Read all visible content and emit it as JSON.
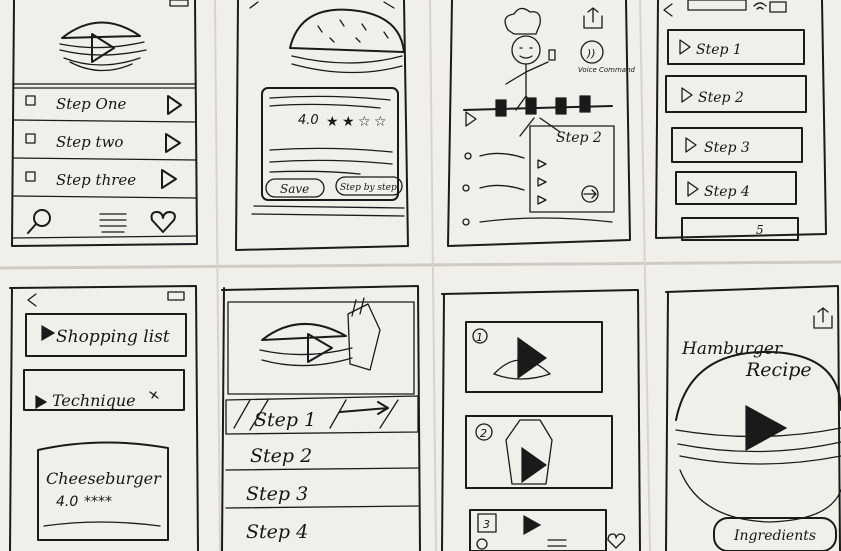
{
  "sheet": {
    "paper_color": "#f1efea",
    "shadow_color": "#d4d1cb",
    "ink_color": "#1a1a1a"
  },
  "frames": {
    "recipe_steps": {
      "steps": [
        {
          "label": "Step One"
        },
        {
          "label": "Step two"
        },
        {
          "label": "Step three"
        }
      ],
      "nav_icons": [
        "search-icon",
        "list-icon",
        "heart-icon"
      ]
    },
    "recipe_detail": {
      "rating_text": "4.0",
      "stars": 3,
      "save_label": "Save",
      "step_by_step_label": "Step by step"
    },
    "chef_mode": {
      "voice_command_label": "Voice Command",
      "popup_step_label": "Step 2"
    },
    "step_list": {
      "steps": [
        "Step 1",
        "Step 2",
        "Step 3",
        "Step 4",
        "5"
      ]
    },
    "menu": {
      "shopping_list_label": "Shopping list",
      "technique_label": "Technique",
      "recipe_card_title": "Cheeseburger",
      "recipe_card_rating": "4.0",
      "recipe_card_stars": "****"
    },
    "video_steps": {
      "steps": [
        "Step 1",
        "Step 2",
        "Step 3",
        "Step 4"
      ]
    },
    "video_list": {
      "numbers": [
        "1",
        "2",
        "3"
      ]
    },
    "hero": {
      "title_line1": "Hamburger",
      "title_line2": "Recipe",
      "ingredients_label": "Ingredients"
    }
  }
}
